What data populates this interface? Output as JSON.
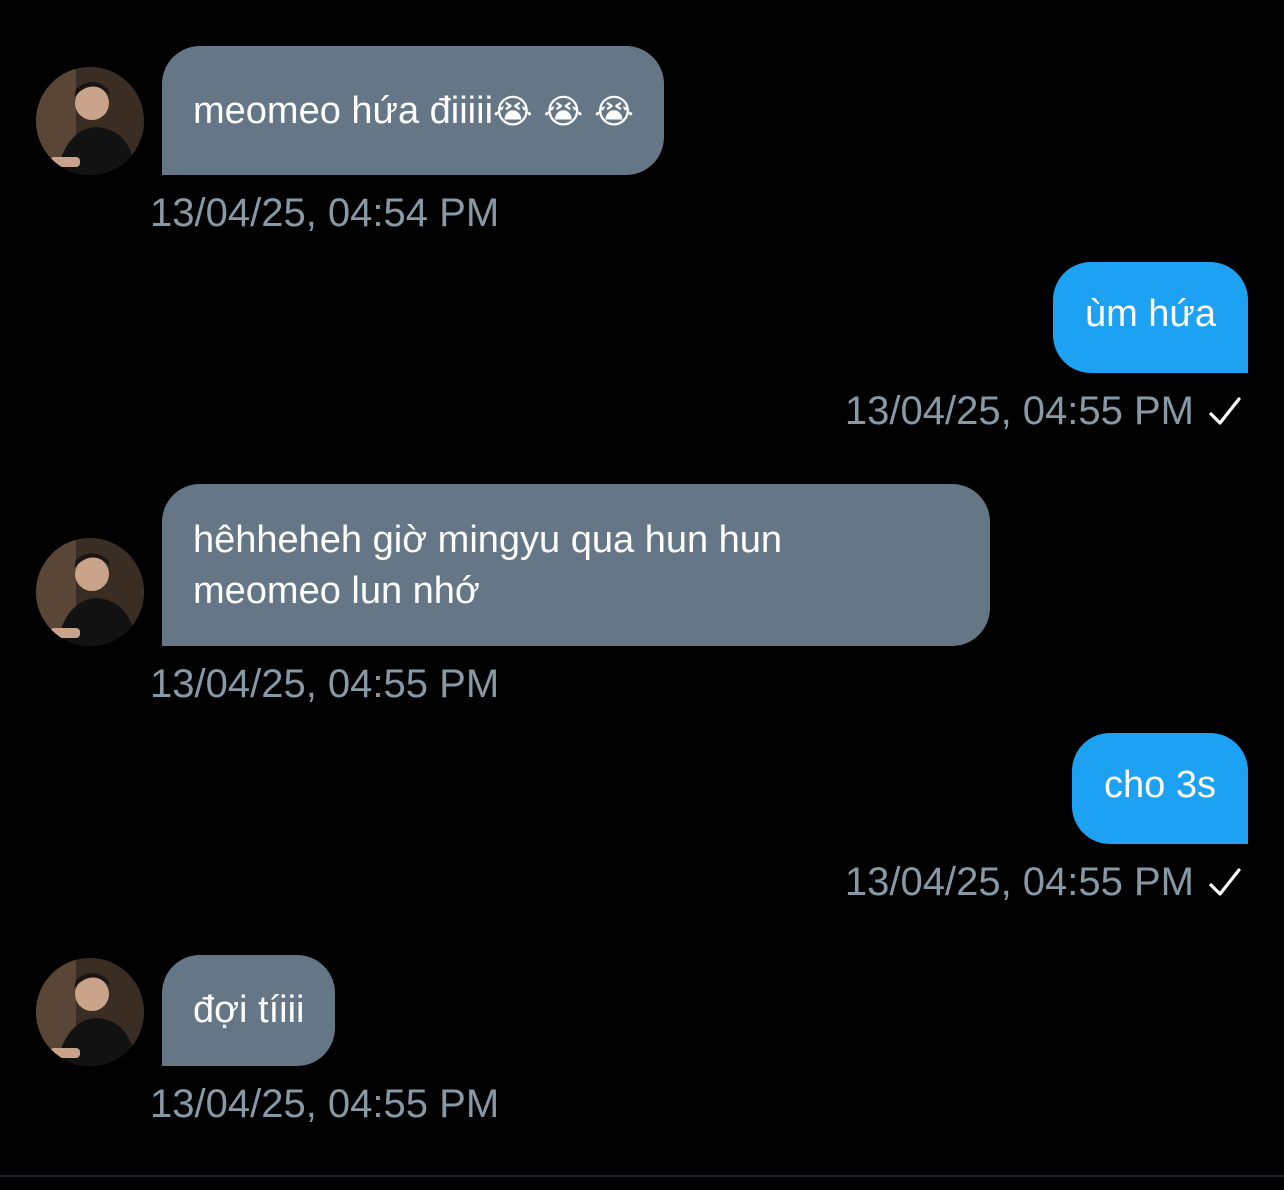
{
  "conversation": {
    "messages": [
      {
        "direction": "received",
        "text": "meomeo hứa điiiii",
        "emoji": "😭 😭 😭",
        "timestamp": "13/04/25, 04:54 PM"
      },
      {
        "direction": "sent",
        "text": "ùm hứa",
        "timestamp": "13/04/25, 04:55 PM",
        "status_icon": "checkmark-icon"
      },
      {
        "direction": "received",
        "text_line_1": "hêhheheh giờ mingyu qua hun hun",
        "text_line_2": "meomeo lun nhớ",
        "timestamp": "13/04/25, 04:55 PM"
      },
      {
        "direction": "sent",
        "text": "cho 3s",
        "timestamp": "13/04/25, 04:55 PM",
        "status_icon": "checkmark-icon"
      },
      {
        "direction": "received",
        "text": "đợi tíiii",
        "timestamp": "13/04/25, 04:55 PM"
      }
    ]
  },
  "colors": {
    "background": "#000000",
    "received_bubble": "#657786",
    "sent_bubble": "#1da1f2",
    "timestamp": "#8899a6",
    "text": "#ffffff"
  }
}
